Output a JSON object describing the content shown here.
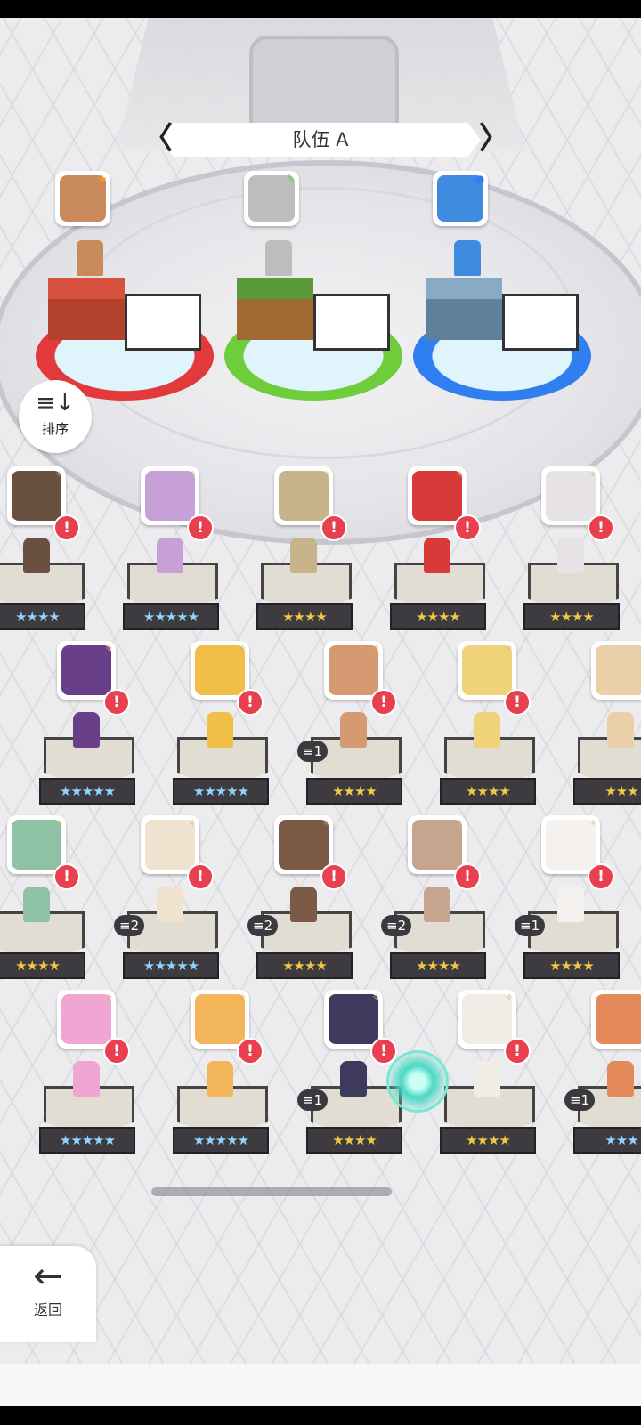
{
  "team": {
    "title": "队伍 A",
    "prev": "〈",
    "next": "〉"
  },
  "team_slots": [
    {
      "name": "slot-1",
      "face": "#c98a5c",
      "badge": "★",
      "badge_color": "#f39a1c",
      "ring": "#e23a3a",
      "block_top": "#d6523f",
      "block_side": "#b4402e"
    },
    {
      "name": "slot-2",
      "face": "#bdbdbd",
      "badge": "✎",
      "badge_color": "#7bc043",
      "ring": "#6fcc3a",
      "block_top": "#5b9a3a",
      "block_side": "#a06a34"
    },
    {
      "name": "slot-3",
      "face": "#3f8be0",
      "badge": "●",
      "badge_color": "#2f7ff0",
      "ring": "#2f7ff0",
      "block_top": "#8aaac4",
      "block_side": "#5f7f9a"
    }
  ],
  "sort": {
    "label": "排序",
    "icon": "sort-icon"
  },
  "roster": {
    "rows": [
      [
        {
          "face": "#6a5040",
          "stars": "★★★★",
          "rainbow": true,
          "alert": "!",
          "dup": ""
        },
        {
          "face": "#c7a0d8",
          "stars": "★★★★★",
          "rainbow": true,
          "alert": "!",
          "dup": ""
        },
        {
          "face": "#c8b48a",
          "stars": "★★★★",
          "rainbow": false,
          "alert": "!",
          "dup": ""
        },
        {
          "face": "#d83a3a",
          "stars": "★★★★",
          "rainbow": false,
          "alert": "!",
          "dup": ""
        },
        {
          "face": "#e7e2e6",
          "stars": "★★★★",
          "rainbow": false,
          "alert": "!",
          "dup": ""
        }
      ],
      [
        {
          "face": "#6a3f8a",
          "stars": "★★★★★",
          "rainbow": true,
          "alert": "!",
          "dup": ""
        },
        {
          "face": "#f0c046",
          "stars": "★★★★★",
          "rainbow": true,
          "alert": "!",
          "dup": ""
        },
        {
          "face": "#d69a72",
          "stars": "★★★★",
          "rainbow": false,
          "alert": "!",
          "dup": "1"
        },
        {
          "face": "#f0d27a",
          "stars": "★★★★",
          "rainbow": false,
          "alert": "!",
          "dup": ""
        },
        {
          "face": "#e9d0a8",
          "stars": "★★★",
          "rainbow": false,
          "alert": "",
          "dup": ""
        }
      ],
      [
        {
          "face": "#8fc2a4",
          "stars": "★★★★",
          "rainbow": false,
          "alert": "!",
          "dup": ""
        },
        {
          "face": "#efe2cf",
          "stars": "★★★★★",
          "rainbow": true,
          "alert": "!",
          "dup": "2"
        },
        {
          "face": "#7a5a45",
          "stars": "★★★★",
          "rainbow": false,
          "alert": "!",
          "dup": "2"
        },
        {
          "face": "#c7a48e",
          "stars": "★★★★",
          "rainbow": false,
          "alert": "!",
          "dup": "2"
        },
        {
          "face": "#f4f1ee",
          "stars": "★★★★",
          "rainbow": false,
          "alert": "!",
          "dup": "1"
        }
      ],
      [
        {
          "face": "#f0a6d2",
          "stars": "★★★★★",
          "rainbow": true,
          "alert": "!",
          "dup": ""
        },
        {
          "face": "#f3b55a",
          "stars": "★★★★★",
          "rainbow": true,
          "alert": "!",
          "dup": ""
        },
        {
          "face": "#3d3a5e",
          "stars": "★★★★",
          "rainbow": false,
          "alert": "!",
          "dup": "1"
        },
        {
          "face": "#f2ece6",
          "stars": "★★★★",
          "rainbow": false,
          "alert": "!",
          "dup": ""
        },
        {
          "face": "#e48a5a",
          "stars": "★★★",
          "rainbow": true,
          "alert": "",
          "dup": "1"
        }
      ]
    ]
  },
  "back": {
    "label": "返回",
    "icon": "back-arrow-icon"
  }
}
